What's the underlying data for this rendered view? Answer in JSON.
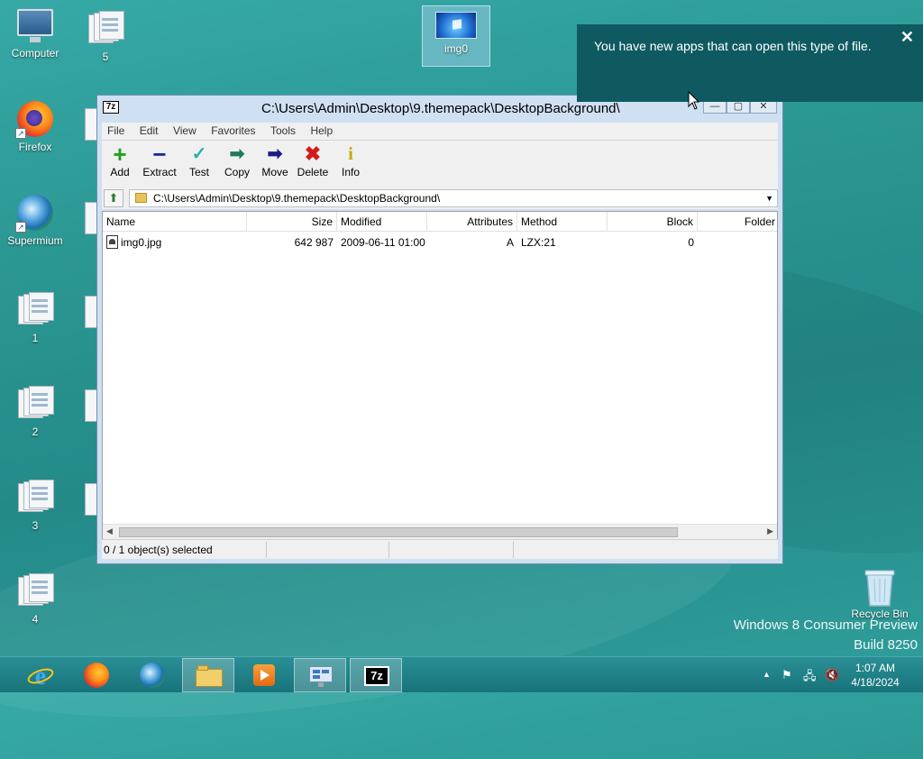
{
  "desktop": {
    "icons": {
      "computer": "Computer",
      "five": "5",
      "img0": "img0",
      "firefox": "Firefox",
      "supermium": "Supermium",
      "one": "1",
      "two": "2",
      "three": "3",
      "four": "4",
      "recycle_bin": "Recycle Bin"
    },
    "watermark_line1": "Windows 8 Consumer Preview",
    "watermark_line2": "Build 8250"
  },
  "notification": {
    "message": "You have new apps that can open this type of file.",
    "close": "✕"
  },
  "window": {
    "app_icon_text": "7z",
    "title": "C:\\Users\\Admin\\Desktop\\9.themepack\\DesktopBackground\\",
    "menu": [
      "File",
      "Edit",
      "View",
      "Favorites",
      "Tools",
      "Help"
    ],
    "toolbar": {
      "add": "Add",
      "extract": "Extract",
      "test": "Test",
      "copy": "Copy",
      "move": "Move",
      "delete": "Delete",
      "info": "Info"
    },
    "address": "C:\\Users\\Admin\\Desktop\\9.themepack\\DesktopBackground\\",
    "columns": {
      "name": "Name",
      "size": "Size",
      "modified": "Modified",
      "attributes": "Attributes",
      "method": "Method",
      "block": "Block",
      "folder": "Folder"
    },
    "files": [
      {
        "name": "img0.jpg",
        "size": "642 987",
        "modified": "2009-06-11 01:00",
        "attributes": "A",
        "method": "LZX:21",
        "block": "0"
      }
    ],
    "status": "0 / 1 object(s) selected"
  },
  "taskbar": {
    "time": "1:07 AM",
    "date": "4/18/2024",
    "items": [
      "internet-explorer",
      "firefox",
      "supermium",
      "file-explorer",
      "media-player",
      "control-panel",
      "7-zip"
    ]
  },
  "colors": {
    "desktop_bg": "#2a9591",
    "taskbar": "#1c7d83",
    "toast_bg": "#0f5a61",
    "window_frame": "#cfe0f2"
  }
}
